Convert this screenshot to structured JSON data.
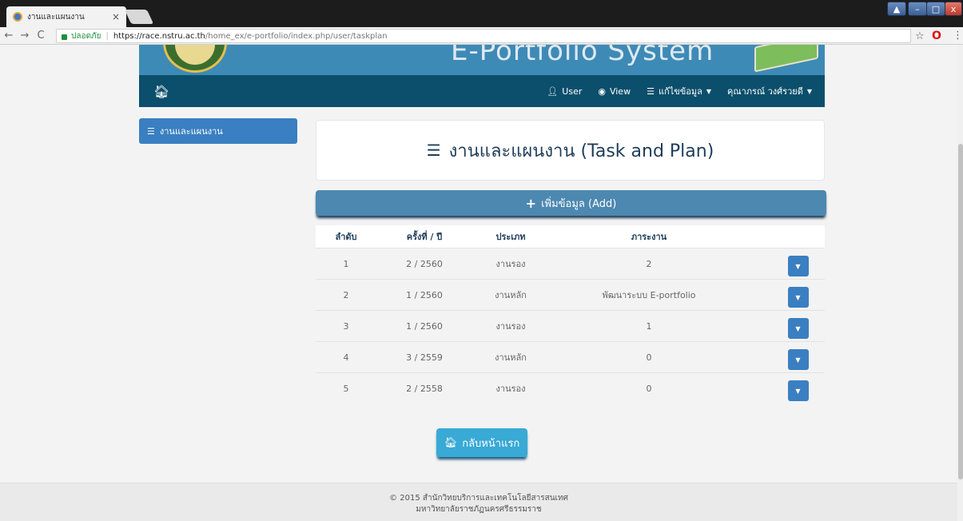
{
  "browser": {
    "tab_title": "งานและแผนงาน",
    "tab_close": "×",
    "secure_label": "ปลอดภัย",
    "url_host": "https://race.nstru.ac.th",
    "url_path": "/home_ex/e-portfolio/index.php/user/taskplan"
  },
  "banner": {
    "title": "E-Portfolio System"
  },
  "navbar": {
    "user": "User",
    "view": "View",
    "edit": "แก้ไขข้อมูล",
    "account": "คุณาภรณ์ วงศ์รวยดี"
  },
  "sidebar": {
    "item_label": "งานและแผนงาน"
  },
  "main": {
    "title": "งานและแผนงาน (Task and Plan)",
    "add_label": "เพิ่มข้อมูล (Add)",
    "home_label": "กลับหน้าแรก"
  },
  "table": {
    "headers": [
      "ลำดับ",
      "ครั้งที่ / ปี",
      "ประเภท",
      "ภาระงาน"
    ],
    "rows": [
      {
        "no": "1",
        "term": "2 / 2560",
        "type": "งานรอง",
        "task": "2"
      },
      {
        "no": "2",
        "term": "1 / 2560",
        "type": "งานหลัก",
        "task": "พัฒนาระบบ E-portfolio"
      },
      {
        "no": "3",
        "term": "1 / 2560",
        "type": "งานรอง",
        "task": "1"
      },
      {
        "no": "4",
        "term": "3 / 2559",
        "type": "งานหลัก",
        "task": "0"
      },
      {
        "no": "5",
        "term": "2 / 2558",
        "type": "งานรอง",
        "task": "0"
      }
    ]
  },
  "footer": {
    "line1": "© 2015 สำนักวิทยบริการและเทคโนโลยีสารสนเทศ",
    "line2": "มหาวิทยาลัยราชภัฏนครศรีธรรมราช"
  },
  "colors": {
    "navbar": "#0b4f6c",
    "primary": "#3a7fc1",
    "add_button": "#4d88b0",
    "home_button": "#39a9d6"
  }
}
